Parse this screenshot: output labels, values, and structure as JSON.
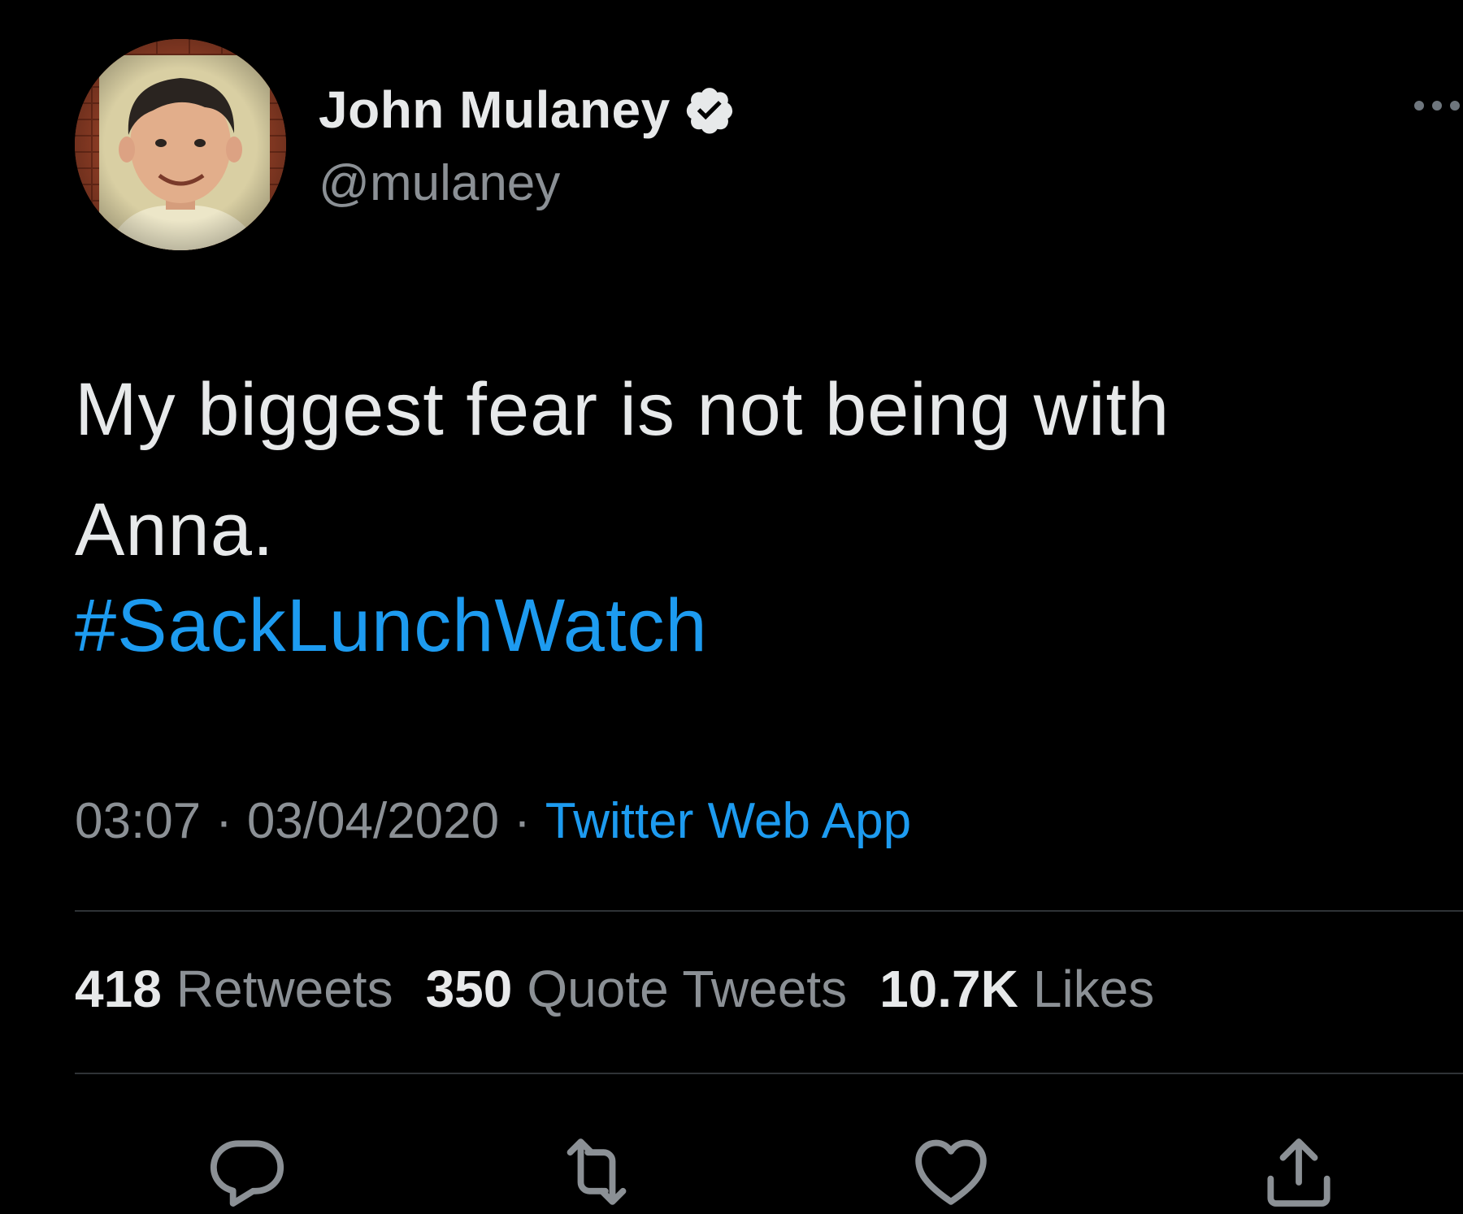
{
  "author": {
    "display_name": "John Mulaney",
    "handle": "@mulaney",
    "verified": true
  },
  "tweet": {
    "text_line_1": "My biggest fear is not being with",
    "text_line_2": "Anna.",
    "hashtag": "#SackLunchWatch"
  },
  "meta": {
    "time": "03:07",
    "separator": "·",
    "date": "03/04/2020",
    "source": "Twitter Web App"
  },
  "stats": {
    "retweets_count": "418",
    "retweets_label": "Retweets",
    "quotes_count": "350",
    "quotes_label": "Quote Tweets",
    "likes_count": "10.7K",
    "likes_label": "Likes"
  },
  "actions": {
    "reply": "reply-icon",
    "retweet": "retweet-icon",
    "like": "heart-icon",
    "share": "share-icon"
  },
  "colors": {
    "background": "#000000",
    "text": "#e7e9ea",
    "muted": "#8b9095",
    "link": "#1d9bf0",
    "divider": "#2f3336"
  }
}
